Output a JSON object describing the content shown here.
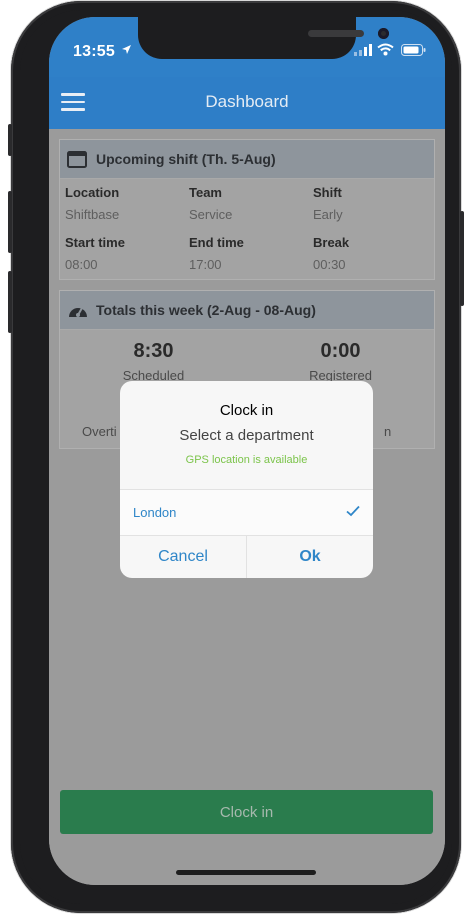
{
  "status": {
    "time": "13:55"
  },
  "header": {
    "title": "Dashboard"
  },
  "shift_card": {
    "title": "Upcoming shift (Th. 5-Aug)",
    "fields": [
      {
        "label": "Location",
        "value": "Shiftbase"
      },
      {
        "label": "Team",
        "value": "Service"
      },
      {
        "label": "Shift",
        "value": "Early"
      },
      {
        "label": "Start time",
        "value": "08:00"
      },
      {
        "label": "End time",
        "value": "17:00"
      },
      {
        "label": "Break",
        "value": "00:30"
      }
    ]
  },
  "totals_card": {
    "title": "Totals this week (2-Aug - 08-Aug)",
    "scheduled_value": "8:30",
    "scheduled_label": "Scheduled",
    "registered_value": "0:00",
    "registered_label": "Registered",
    "overtime_label_partial": "Overti",
    "right_label_partial": "n"
  },
  "dialog": {
    "title": "Clock in",
    "subtitle": "Select a department",
    "gps_status": "GPS location is available",
    "option": "London",
    "cancel_label": "Cancel",
    "ok_label": "Ok"
  },
  "footer": {
    "clock_in_label": "Clock in"
  },
  "colors": {
    "navbar": "#2e7ec7",
    "clock_in_button": "#2a7c4d",
    "link_blue": "#2f86c8",
    "gps_green": "#7cc44b"
  }
}
